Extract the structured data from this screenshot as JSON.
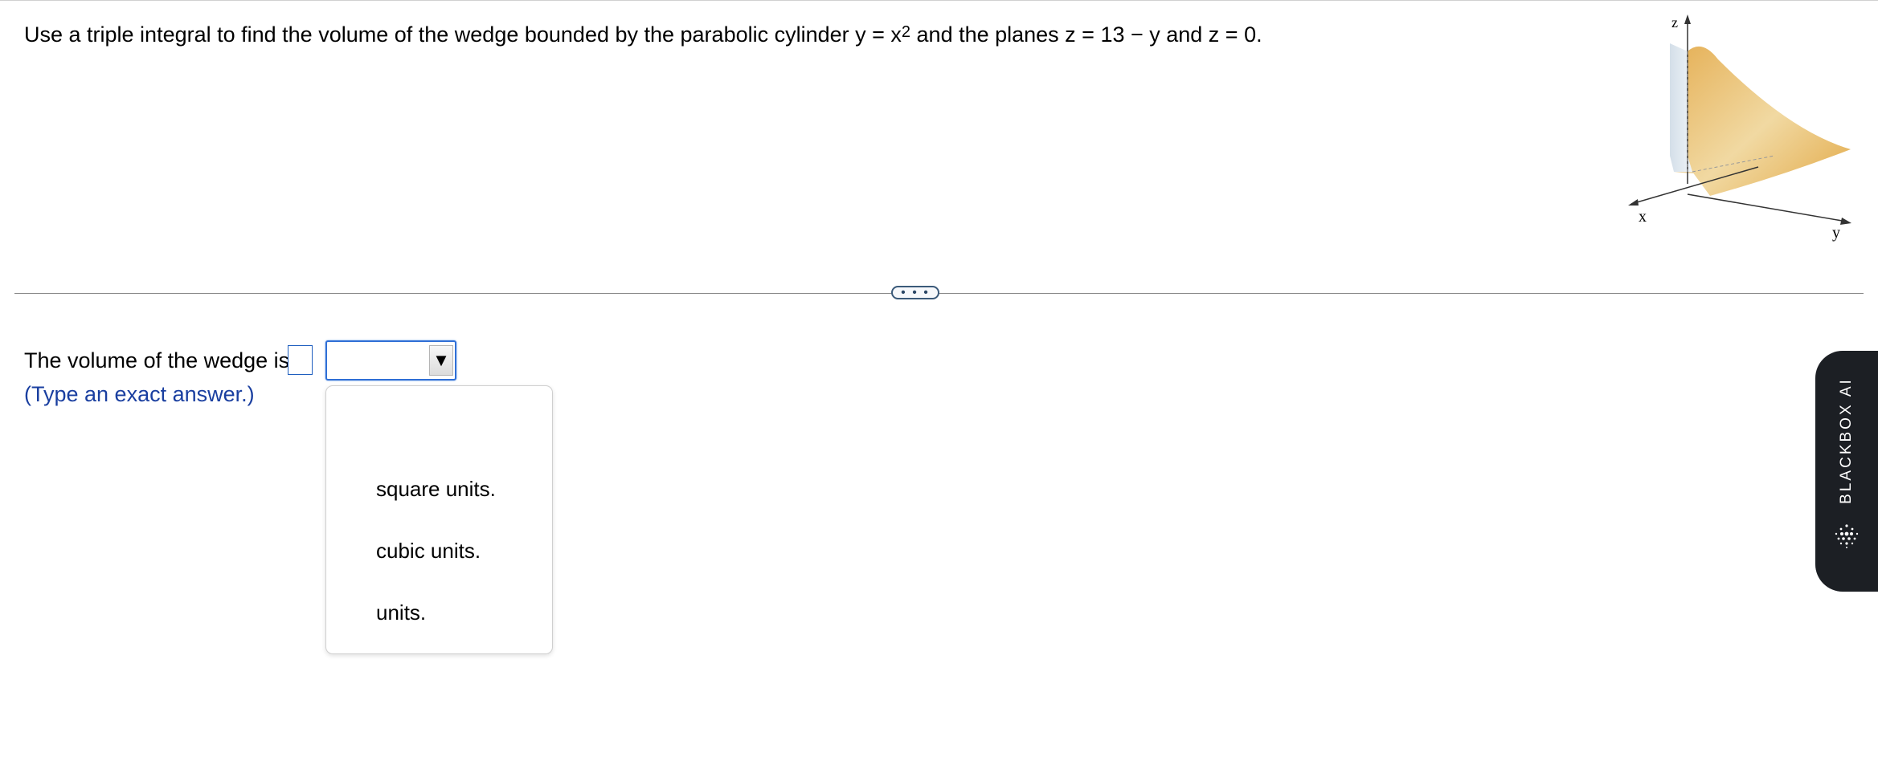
{
  "question": {
    "prefix": "Use a triple integral to find the volume of the wedge bounded by the parabolic cylinder y = x",
    "exponent": "2",
    "suffix": " and the planes z = 13 − y and z = 0."
  },
  "figure": {
    "axis_x": "x",
    "axis_y": "y",
    "axis_z": "z",
    "surface_color": "#e8b866"
  },
  "divider": {
    "expand_label": "• • •"
  },
  "answer": {
    "label": "The volume of the wedge is",
    "input_value": "",
    "select_value": "",
    "hint": "(Type an exact answer.)"
  },
  "dropdown": {
    "options": [
      "square units.",
      "cubic units.",
      "units."
    ]
  },
  "side_tab": {
    "label": "BLACKBOX AI"
  },
  "colors": {
    "accent": "#2f6fd6",
    "hint_text": "#1a3fa0",
    "tab_bg": "#1c1f24"
  }
}
